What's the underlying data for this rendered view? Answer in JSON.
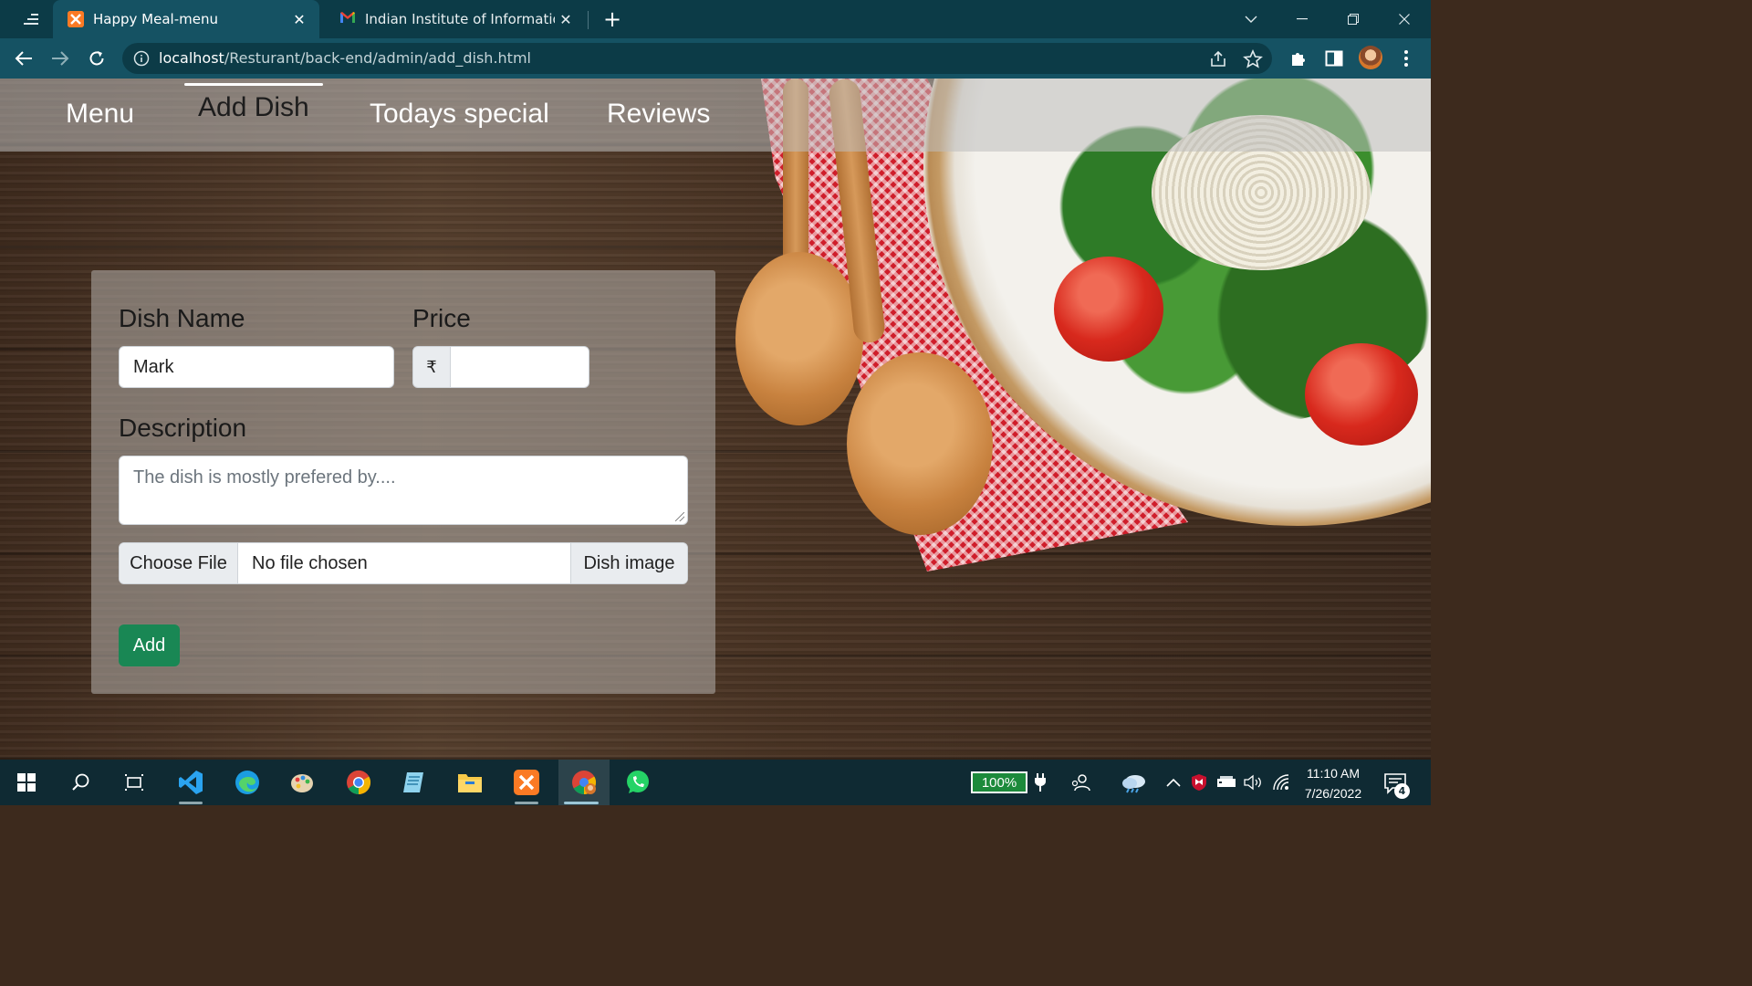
{
  "browser": {
    "tabs": [
      {
        "title": "Happy Meal-menu",
        "active": true,
        "icon": "xampp-icon"
      },
      {
        "title": "Indian Institute of Information Te",
        "active": false,
        "icon": "gmail-icon"
      }
    ],
    "url_host": "localhost",
    "url_path": "/Resturant/back-end/admin/add_dish.html"
  },
  "nav": {
    "items": [
      {
        "label": "Menu",
        "active": false
      },
      {
        "label": "Add Dish",
        "active": true
      },
      {
        "label": "Todays special",
        "active": false
      },
      {
        "label": "Reviews",
        "active": false
      }
    ]
  },
  "form": {
    "dish_name_label": "Dish Name",
    "dish_name_value": "Mark",
    "price_label": "Price",
    "currency_symbol": "₹",
    "price_value": "",
    "description_label": "Description",
    "description_placeholder": "The dish is mostly prefered by....",
    "file_button": "Choose File",
    "file_status": "No file chosen",
    "file_addon": "Dish image",
    "submit_label": "Add"
  },
  "taskbar": {
    "battery": "100%",
    "time": "11:10 AM",
    "date": "7/26/2022",
    "notification_count": "4"
  },
  "colors": {
    "tab_bar": "#0c3b47",
    "toolbar": "#155263",
    "add_button": "#198754",
    "taskbar": "#0f2a33"
  }
}
